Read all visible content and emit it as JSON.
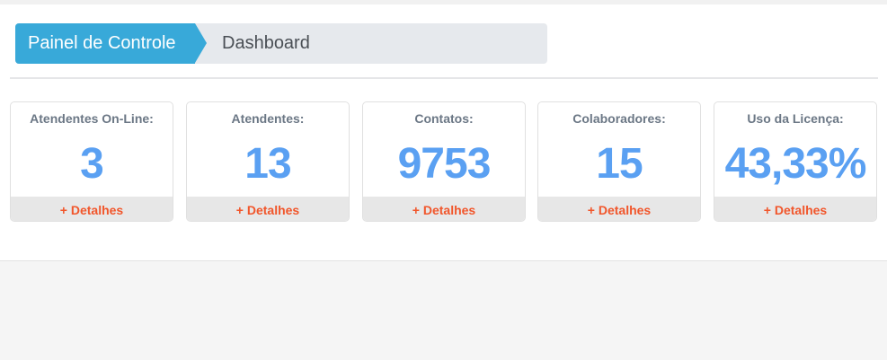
{
  "breadcrumb": {
    "home": "Painel de Controle",
    "current": "Dashboard"
  },
  "cards": [
    {
      "label": "Atendentes On-Line:",
      "value": "3",
      "details": "+ Detalhes"
    },
    {
      "label": "Atendentes:",
      "value": "13",
      "details": "+ Detalhes"
    },
    {
      "label": "Contatos:",
      "value": "9753",
      "details": "+ Detalhes"
    },
    {
      "label": "Colaboradores:",
      "value": "15",
      "details": "+ Detalhes"
    },
    {
      "label": "Uso da Licença:",
      "value": "43,33%",
      "details": "+ Detalhes"
    }
  ],
  "colors": {
    "breadcrumb_accent": "#38a9d9",
    "value_color": "#5aa0f2",
    "details_color": "#f1562b"
  }
}
